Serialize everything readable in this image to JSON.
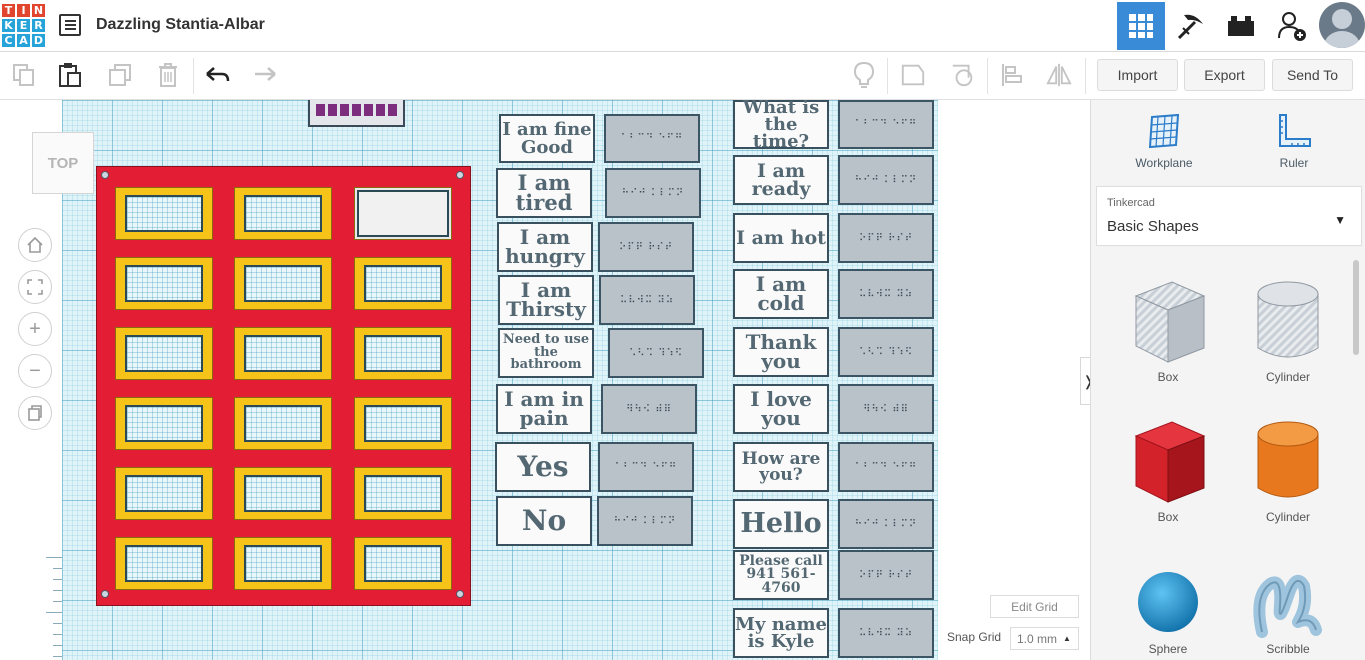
{
  "header": {
    "logo_letters": [
      "T",
      "I",
      "N",
      "K",
      "E",
      "R",
      "C",
      "A",
      "D"
    ],
    "logo_colors": [
      "#e2452d",
      "#e2452d",
      "#e2452d",
      "#26a3d9",
      "#26a3d9",
      "#26a3d9",
      "#26a3d9",
      "#26a3d9",
      "#26a3d9"
    ],
    "design_title": "Dazzling Stantia-Albar"
  },
  "toolbar": {
    "import_label": "Import",
    "export_label": "Export",
    "send_to_label": "Send To"
  },
  "viewcube": {
    "label": "TOP"
  },
  "board_cards": {
    "col1": [
      "I am fine Good",
      "I am tired",
      "I am hungry",
      "I am Thirsty",
      "Need to use the bathroom",
      "I am in pain",
      "Yes",
      "No"
    ],
    "col2": [
      "What is the time?",
      "I am ready",
      "I am hot",
      "I am cold",
      "Thank you",
      "I love you",
      "How are you?",
      "Hello",
      "Please call 941 561-4760",
      "My name is Kyle"
    ]
  },
  "grid_controls": {
    "edit_grid_label": "Edit Grid",
    "snap_grid_label": "Snap Grid",
    "snap_value": "1.0 mm"
  },
  "panel": {
    "workplane_label": "Workplane",
    "ruler_label": "Ruler",
    "library_small": "Tinkercad",
    "library_name": "Basic Shapes",
    "shapes": [
      {
        "label": "Box",
        "icon": "box-hole-icon"
      },
      {
        "label": "Cylinder",
        "icon": "cylinder-hole-icon"
      },
      {
        "label": "Box",
        "icon": "box-solid-icon",
        "color": "#d3222a"
      },
      {
        "label": "Cylinder",
        "icon": "cylinder-solid-icon",
        "color": "#e8781d"
      },
      {
        "label": "Sphere",
        "icon": "sphere-icon",
        "color": "#1b8fcf"
      },
      {
        "label": "Scribble",
        "icon": "scribble-icon",
        "color": "#9fc4dd"
      }
    ]
  },
  "colors": {
    "accent": "#3a8bd7",
    "board_red": "#e21d34",
    "slot_yellow": "#f6c319",
    "grid": "#dff3f8"
  }
}
